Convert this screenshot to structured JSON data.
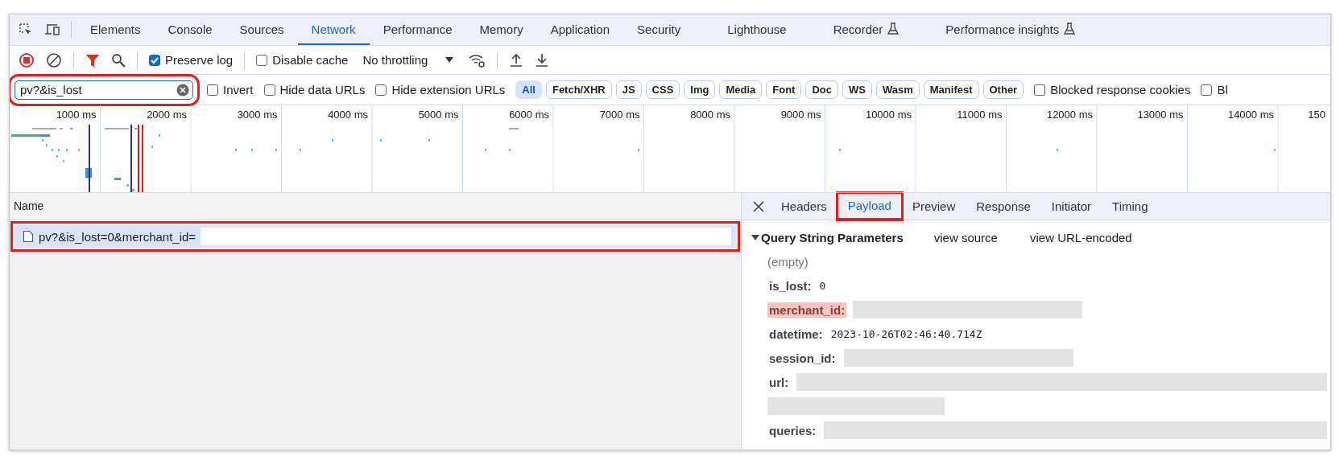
{
  "panel_tabs": [
    {
      "label": "Elements",
      "selected": false,
      "experimental": false
    },
    {
      "label": "Console",
      "selected": false,
      "experimental": false
    },
    {
      "label": "Sources",
      "selected": false,
      "experimental": false
    },
    {
      "label": "Network",
      "selected": true,
      "experimental": false
    },
    {
      "label": "Performance",
      "selected": false,
      "experimental": false
    },
    {
      "label": "Memory",
      "selected": false,
      "experimental": false
    },
    {
      "label": "Application",
      "selected": false,
      "experimental": false
    },
    {
      "label": "Security",
      "selected": false,
      "experimental": false
    },
    {
      "label": "Lighthouse",
      "selected": false,
      "experimental": false
    },
    {
      "label": "Recorder",
      "selected": false,
      "experimental": true
    },
    {
      "label": "Performance insights",
      "selected": false,
      "experimental": true
    }
  ],
  "network_toolbar": {
    "preserve_log": {
      "label": "Preserve log",
      "checked": true
    },
    "disable_cache": {
      "label": "Disable cache",
      "checked": false
    },
    "throttling": "No throttling"
  },
  "filter": {
    "value": "pv?&is_lost",
    "highlighted": true
  },
  "filter_options": [
    {
      "label": "Invert",
      "checked": false
    },
    {
      "label": "Hide data URLs",
      "checked": false
    },
    {
      "label": "Hide extension URLs",
      "checked": false
    }
  ],
  "resource_types": [
    {
      "label": "All",
      "selected": true
    },
    {
      "label": "Fetch/XHR",
      "selected": false
    },
    {
      "label": "JS",
      "selected": false
    },
    {
      "label": "CSS",
      "selected": false
    },
    {
      "label": "Img",
      "selected": false
    },
    {
      "label": "Media",
      "selected": false
    },
    {
      "label": "Font",
      "selected": false
    },
    {
      "label": "Doc",
      "selected": false
    },
    {
      "label": "WS",
      "selected": false
    },
    {
      "label": "Wasm",
      "selected": false
    },
    {
      "label": "Manifest",
      "selected": false
    },
    {
      "label": "Other",
      "selected": false
    }
  ],
  "extra_filters": [
    {
      "label": "Blocked response cookies",
      "checked": false
    },
    {
      "label": "Bl",
      "checked": false
    }
  ],
  "timeline": {
    "ticks": [
      "1000 ms",
      "2000 ms",
      "3000 ms",
      "4000 ms",
      "5000 ms",
      "6000 ms",
      "7000 ms",
      "8000 ms",
      "9000 ms",
      "10000 ms",
      "11000 ms",
      "12000 ms",
      "13000 ms",
      "14000 ms",
      "150"
    ]
  },
  "requests": {
    "column": "Name",
    "rows": [
      {
        "name": "pv?&is_lost=0&merchant_id=",
        "selected": true,
        "highlighted": true,
        "redacted": true
      }
    ]
  },
  "details": {
    "tabs": [
      {
        "label": "Headers",
        "selected": false,
        "highlighted": false
      },
      {
        "label": "Payload",
        "selected": true,
        "highlighted": true
      },
      {
        "label": "Preview",
        "selected": false,
        "highlighted": false
      },
      {
        "label": "Response",
        "selected": false,
        "highlighted": false
      },
      {
        "label": "Initiator",
        "selected": false,
        "highlighted": false
      },
      {
        "label": "Timing",
        "selected": false,
        "highlighted": false
      }
    ],
    "section": {
      "title": "Query String Parameters",
      "expanded": true,
      "links": [
        "view source",
        "view URL-encoded"
      ]
    },
    "empty_label": "(empty)",
    "params": [
      {
        "name": "is_lost:",
        "kind": "value",
        "value": "0",
        "highlighted": false
      },
      {
        "name": "merchant_id:",
        "kind": "redacted",
        "highlighted": true
      },
      {
        "name": "datetime:",
        "kind": "value",
        "value": "2023-10-26T02:46:40.714Z",
        "highlighted": false
      },
      {
        "name": "session_id:",
        "kind": "redacted",
        "highlighted": false
      },
      {
        "name": "url:",
        "kind": "redacted_wrapped",
        "highlighted": false
      },
      {
        "name": "queries:",
        "kind": "redacted_long",
        "highlighted": false
      }
    ]
  }
}
